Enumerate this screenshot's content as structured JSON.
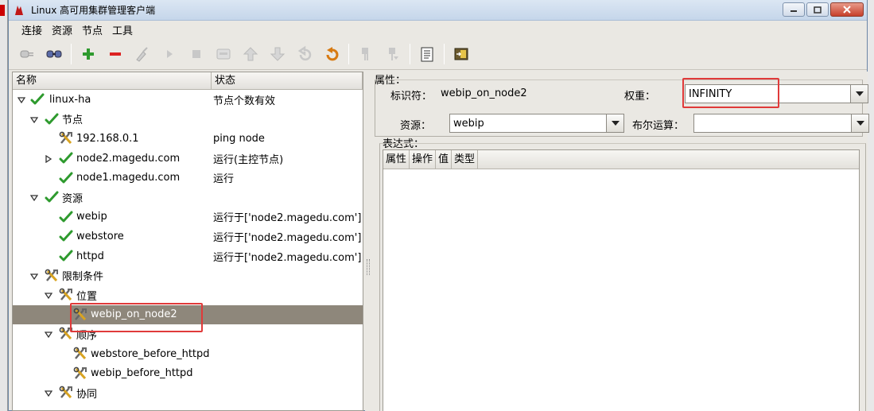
{
  "window": {
    "title": "Linux 高可用集群管理客户端"
  },
  "menu": [
    "连接",
    "资源",
    "节点",
    "工具"
  ],
  "toolbar": [
    "connect-icon",
    "disconnect-icon",
    "add-icon",
    "remove-icon",
    "cleanup-icon",
    "start-icon",
    "stop-icon",
    "migrate-icon",
    "move-up-icon",
    "move-down-icon",
    "undo-icon",
    "refresh-icon",
    "standby-icon",
    "active-icon",
    "document-icon",
    "exit-icon"
  ],
  "tree": {
    "headers": {
      "name": "名称",
      "status": "状态"
    },
    "rows": [
      {
        "label": "linux-ha",
        "status": "节点个数有效"
      },
      {
        "label": "节点",
        "status": ""
      },
      {
        "label": "192.168.0.1",
        "status": "ping node"
      },
      {
        "label": "node2.magedu.com",
        "status": "运行(主控节点)"
      },
      {
        "label": "node1.magedu.com",
        "status": "运行"
      },
      {
        "label": "资源",
        "status": ""
      },
      {
        "label": "webip",
        "status": "运行于['node2.magedu.com']"
      },
      {
        "label": "webstore",
        "status": "运行于['node2.magedu.com']"
      },
      {
        "label": "httpd",
        "status": "运行于['node2.magedu.com']"
      },
      {
        "label": "限制条件",
        "status": ""
      },
      {
        "label": "位置",
        "status": ""
      },
      {
        "label": "webip_on_node2",
        "status": ""
      },
      {
        "label": "顺序",
        "status": ""
      },
      {
        "label": "webstore_before_httpd",
        "status": ""
      },
      {
        "label": "webip_before_httpd",
        "status": ""
      },
      {
        "label": "协同",
        "status": ""
      }
    ]
  },
  "details": {
    "attributes_label": "属性：",
    "id_label": "标识符：",
    "id_value": "webip_on_node2",
    "weight_label": "权重：",
    "weight_value": "INFINITY",
    "resource_label": "资源：",
    "resource_value": "webip",
    "bool_label": "布尔运算：",
    "bool_value": "",
    "expression_label": "表达式：",
    "table_headers": [
      "属性",
      "操作",
      "值",
      "类型"
    ]
  },
  "colors": {
    "highlight": "#e03a3a",
    "selected_row": "#8e877b"
  }
}
